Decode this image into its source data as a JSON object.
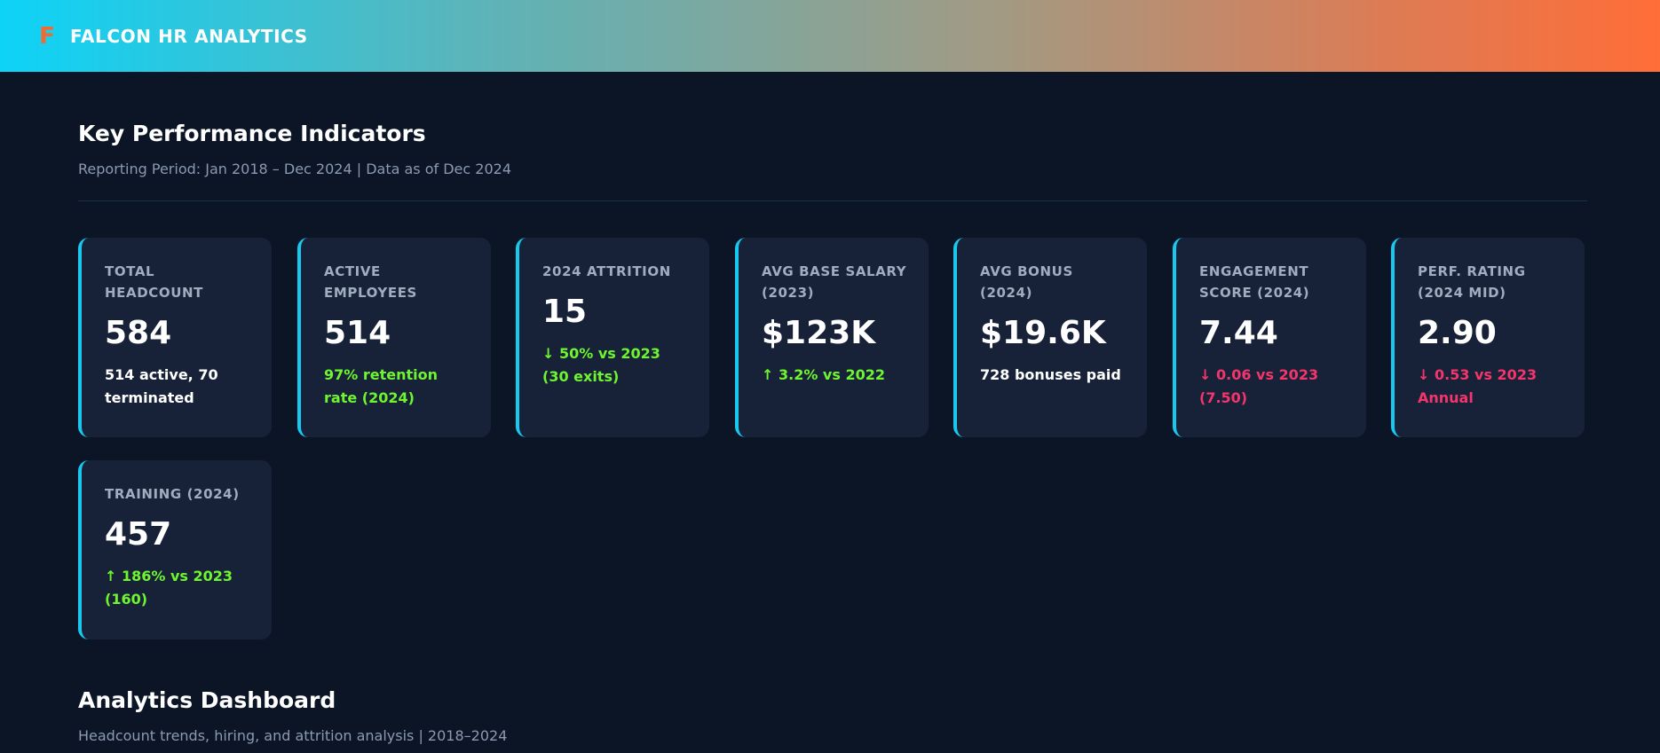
{
  "header": {
    "logo_glyph": "F",
    "brand": "FALCON HR ANALYTICS",
    "accent_start": "#0dd3f7",
    "accent_end": "#ff6d38"
  },
  "kpi_section": {
    "title": "Key Performance Indicators",
    "subtitle": "Reporting Period: Jan 2018 – Dec 2024 | Data as of Dec 2024"
  },
  "kpis": [
    {
      "label": "TOTAL HEADCOUNT",
      "value": "584",
      "note": "514 active, 70 terminated",
      "note_status": "neutral"
    },
    {
      "label": "ACTIVE EMPLOYEES",
      "value": "514",
      "note": "97% retention rate (2024)",
      "note_status": "good"
    },
    {
      "label": "2024 ATTRITION",
      "value": "15",
      "note": "↓ 50% vs 2023 (30 exits)",
      "note_status": "good"
    },
    {
      "label": "AVG BASE SALARY (2023)",
      "value": "$123K",
      "note": "↑ 3.2% vs 2022",
      "note_status": "good"
    },
    {
      "label": "AVG BONUS (2024)",
      "value": "$19.6K",
      "note": "728 bonuses paid",
      "note_status": "neutral"
    },
    {
      "label": "ENGAGEMENT SCORE (2024)",
      "value": "7.44",
      "note": "↓ 0.06 vs 2023 (7.50)",
      "note_status": "bad"
    },
    {
      "label": "PERF. RATING (2024 MID)",
      "value": "2.90",
      "note": "↓ 0.53 vs 2023 Annual",
      "note_status": "bad"
    },
    {
      "label": "TRAINING (2024)",
      "value": "457",
      "note": "↑ 186% vs 2023 (160)",
      "note_status": "good"
    }
  ],
  "analytics_section": {
    "title": "Analytics Dashboard",
    "subtitle": "Headcount trends, hiring, and attrition analysis | 2018–2024"
  },
  "colors": {
    "background": "#0b1526",
    "card": "#172238",
    "card_accent": "#19c8ef",
    "good": "#6ef52f",
    "bad": "#f4356b"
  }
}
